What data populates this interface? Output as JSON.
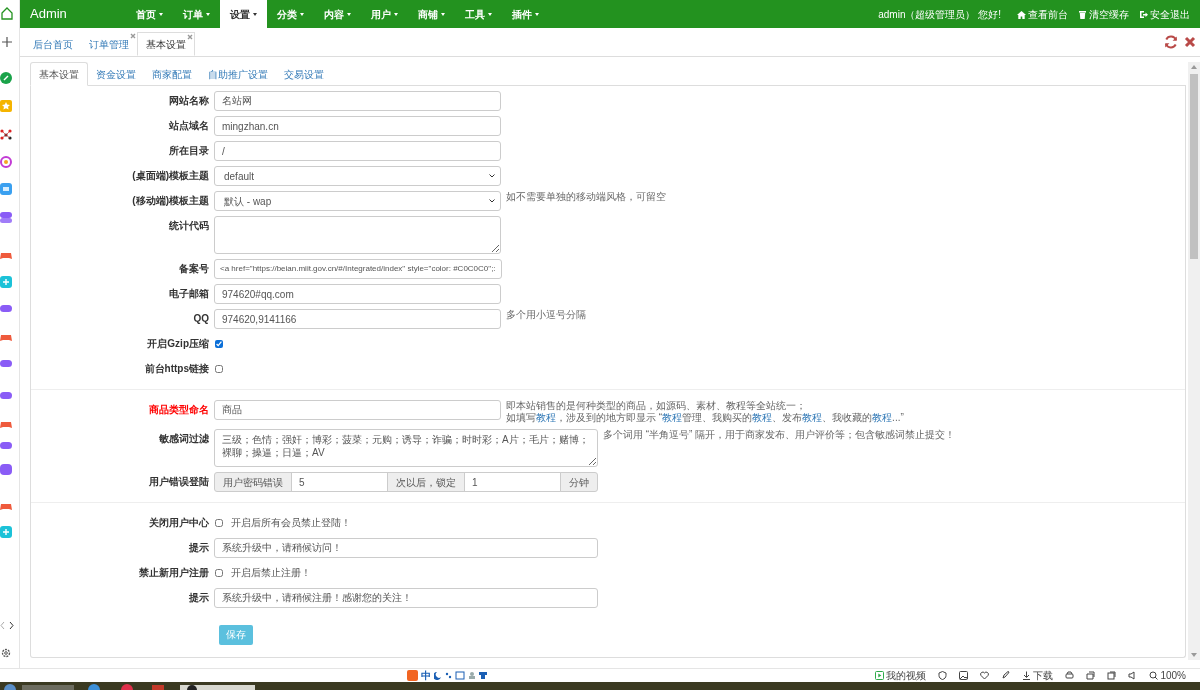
{
  "navbar": {
    "brand": "Admin",
    "menus": [
      {
        "label": "首页",
        "selected": false
      },
      {
        "label": "订单",
        "selected": false
      },
      {
        "label": "设置",
        "selected": true
      },
      {
        "label": "分类",
        "selected": false
      },
      {
        "label": "内容",
        "selected": false
      },
      {
        "label": "用户",
        "selected": false
      },
      {
        "label": "商铺",
        "selected": false
      },
      {
        "label": "工具",
        "selected": false
      },
      {
        "label": "插件",
        "selected": false
      }
    ],
    "greeting": "admin（超级管理员） 您好!",
    "links": [
      {
        "kind": "home",
        "label": "查看前台"
      },
      {
        "kind": "trash",
        "label": "清空缓存"
      },
      {
        "kind": "logout",
        "label": "安全退出"
      }
    ]
  },
  "page_tabs": [
    {
      "label": "后台首页",
      "selected": false,
      "closable": false
    },
    {
      "label": "订单管理",
      "selected": false,
      "closable": true
    },
    {
      "label": "基本设置",
      "selected": true,
      "closable": true
    }
  ],
  "settings_tabs": [
    {
      "label": "基本设置",
      "selected": true
    },
    {
      "label": "资金设置",
      "selected": false
    },
    {
      "label": "商家配置",
      "selected": false
    },
    {
      "label": "自助推广设置",
      "selected": false
    },
    {
      "label": "交易设置",
      "selected": false
    }
  ],
  "sections": [
    {
      "rows": [
        {
          "kind": "input",
          "label": "网站名称",
          "highlighted": false,
          "value": "名站网"
        },
        {
          "kind": "input",
          "label": "站点域名",
          "highlighted": false,
          "value": "mingzhan.cn"
        },
        {
          "kind": "input",
          "label": "所在目录",
          "highlighted": false,
          "value": "/"
        },
        {
          "kind": "select",
          "label": "(桌面端)模板主题",
          "highlighted": false,
          "value": "default"
        },
        {
          "kind": "select",
          "label": "(移动端)模板主题",
          "highlighted": false,
          "value": "默认 - wap",
          "hint": [
            [
              {
                "text": "如不需要单独的移动端风格，可留空",
                "link": false
              }
            ]
          ]
        },
        {
          "kind": "textarea",
          "label": "统计代码",
          "highlighted": false,
          "wide": false
        },
        {
          "kind": "input",
          "label": "备案号",
          "highlighted": false,
          "value": "<a href=\"https://beian.miit.gov.cn/#/Integrated/index\" style=\"color: #C0C0C0\";:"
        },
        {
          "kind": "input",
          "label": "电子邮箱",
          "highlighted": false,
          "value": "974620#qq.com"
        },
        {
          "kind": "input",
          "label": "QQ",
          "highlighted": false,
          "value": "974620,9141166",
          "hint": [
            [
              {
                "text": "多个用小逗号分隔",
                "link": false
              }
            ]
          ]
        },
        {
          "kind": "checkbox",
          "label": "开启Gzip压缩",
          "highlighted": false,
          "checked": true
        },
        {
          "kind": "checkbox",
          "label": "前台https链接",
          "highlighted": false,
          "checked": false
        }
      ]
    },
    {
      "rows": [
        {
          "kind": "input",
          "label": "商品类型命名",
          "highlighted": true,
          "value": "商品",
          "hint": [
            [
              {
                "text": "即本站销售的是何种类型的商品，如源码、素材、教程等全站统一；",
                "link": false
              }
            ],
            [
              {
                "text": "如填写",
                "link": false
              },
              {
                "text": "教程",
                "link": true
              },
              {
                "text": "，涉及到的地方即显示 “",
                "link": false
              },
              {
                "text": "教程",
                "link": true
              },
              {
                "text": "管理、我购买的",
                "link": false
              },
              {
                "text": "教程",
                "link": true
              },
              {
                "text": "、发布",
                "link": false
              },
              {
                "text": "教程",
                "link": true
              },
              {
                "text": "、我收藏的",
                "link": false
              },
              {
                "text": "教程",
                "link": true
              },
              {
                "text": "...”",
                "link": false
              }
            ]
          ]
        },
        {
          "kind": "textarea",
          "label": "敏感词过滤",
          "highlighted": false,
          "wide": true,
          "value": "三级；色情；强奸；博彩；菠菜；元购；诱导；诈骗；时时彩；A片；毛片；赌博；裸聊；操逼；日逼；AV",
          "hint": [
            [
              {
                "text": "多个词用 “半角逗号” 隔开，用于商家发布、用户评价等；包含敏感词禁止提交！",
                "link": false
              }
            ]
          ]
        },
        {
          "kind": "group",
          "label": "用户错误登陆",
          "highlighted": false,
          "parts": [
            {
              "kind": "addon",
              "text": "用户密码错误"
            },
            {
              "kind": "input",
              "value": "5"
            },
            {
              "kind": "addon",
              "text": "次以后，锁定"
            },
            {
              "kind": "input",
              "value": "1"
            },
            {
              "kind": "addon",
              "text": "分钟"
            }
          ]
        }
      ]
    },
    {
      "rows": [
        {
          "kind": "checkbox",
          "label": "关闭用户中心",
          "highlighted": false,
          "checked": false,
          "caption": "开启后所有会员禁止登陆！"
        },
        {
          "kind": "wide_input",
          "label": "提示",
          "highlighted": false,
          "value": "系统升级中，请稍候访问！"
        },
        {
          "kind": "checkbox",
          "label": "禁止新用户注册",
          "highlighted": false,
          "checked": false,
          "caption": "开启后禁止注册！"
        },
        {
          "kind": "wide_input",
          "label": "提示",
          "highlighted": false,
          "value": "系统升级中，请稍候注册！感谢您的关注！"
        }
      ]
    }
  ],
  "save_button": "保存",
  "ime": {
    "label": "中"
  },
  "browser_status": [
    {
      "kind": "video",
      "label": "我的视频"
    },
    {
      "kind": "shield"
    },
    {
      "kind": "image"
    },
    {
      "kind": "heart"
    },
    {
      "kind": "rocket"
    },
    {
      "kind": "download",
      "label": "下载"
    },
    {
      "kind": "car"
    },
    {
      "kind": "layers"
    },
    {
      "kind": "window"
    },
    {
      "kind": "sound"
    },
    {
      "kind": "zoom",
      "label": "100%"
    }
  ]
}
